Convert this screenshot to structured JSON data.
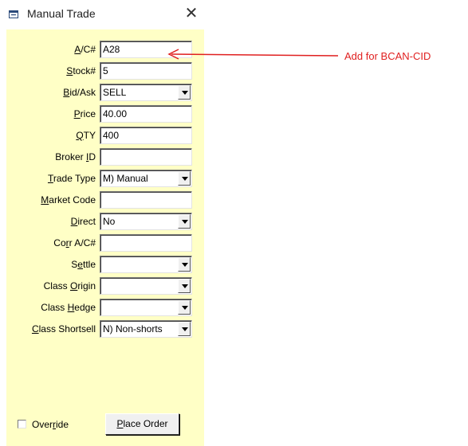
{
  "window": {
    "title": "Manual Trade",
    "close_symbol": "✕"
  },
  "fields": [
    {
      "name": "ac-field",
      "label_pre": "",
      "label_key": "A",
      "label_post": "/C#",
      "value": "A28",
      "type": "text"
    },
    {
      "name": "stock-field",
      "label_pre": "",
      "label_key": "S",
      "label_post": "tock#",
      "value": "5",
      "type": "text"
    },
    {
      "name": "bid-ask-select",
      "label_pre": "",
      "label_key": "B",
      "label_post": "id/Ask",
      "value": "SELL",
      "type": "select"
    },
    {
      "name": "price-field",
      "label_pre": "",
      "label_key": "P",
      "label_post": "rice",
      "value": "40.00",
      "type": "text"
    },
    {
      "name": "qty-field",
      "label_pre": "",
      "label_key": "Q",
      "label_post": "TY",
      "value": "400",
      "type": "text"
    },
    {
      "name": "broker-id-field",
      "label_pre": "Broker ",
      "label_key": "I",
      "label_post": "D",
      "value": "",
      "type": "text"
    },
    {
      "name": "trade-type-select",
      "label_pre": "",
      "label_key": "T",
      "label_post": "rade Type",
      "value": "M) Manual",
      "type": "select"
    },
    {
      "name": "market-code-field",
      "label_pre": "",
      "label_key": "M",
      "label_post": "arket Code",
      "value": "",
      "type": "text"
    },
    {
      "name": "direct-select",
      "label_pre": "",
      "label_key": "D",
      "label_post": "irect",
      "value": "No",
      "type": "select"
    },
    {
      "name": "corr-ac-field",
      "label_pre": "Co",
      "label_key": "r",
      "label_post": "r A/C#",
      "value": "",
      "type": "text"
    },
    {
      "name": "settle-select",
      "label_pre": "S",
      "label_key": "e",
      "label_post": "ttle",
      "value": "",
      "type": "select"
    },
    {
      "name": "class-origin-select",
      "label_pre": "Class ",
      "label_key": "O",
      "label_post": "rigin",
      "value": "",
      "type": "select"
    },
    {
      "name": "class-hedge-select",
      "label_pre": "Class ",
      "label_key": "H",
      "label_post": "edge",
      "value": "",
      "type": "select"
    },
    {
      "name": "class-shortsell-select",
      "label_pre": "",
      "label_key": "C",
      "label_post": "lass Shortsell",
      "value": "N) Non-shorts",
      "type": "select"
    }
  ],
  "override": {
    "pre": "Over",
    "key": "r",
    "post": "ide",
    "checked": false
  },
  "place_order": {
    "pre": "",
    "key": "P",
    "post": "lace Order"
  },
  "annotation": {
    "text": "Add for BCAN-CID",
    "color": "#e02020"
  }
}
